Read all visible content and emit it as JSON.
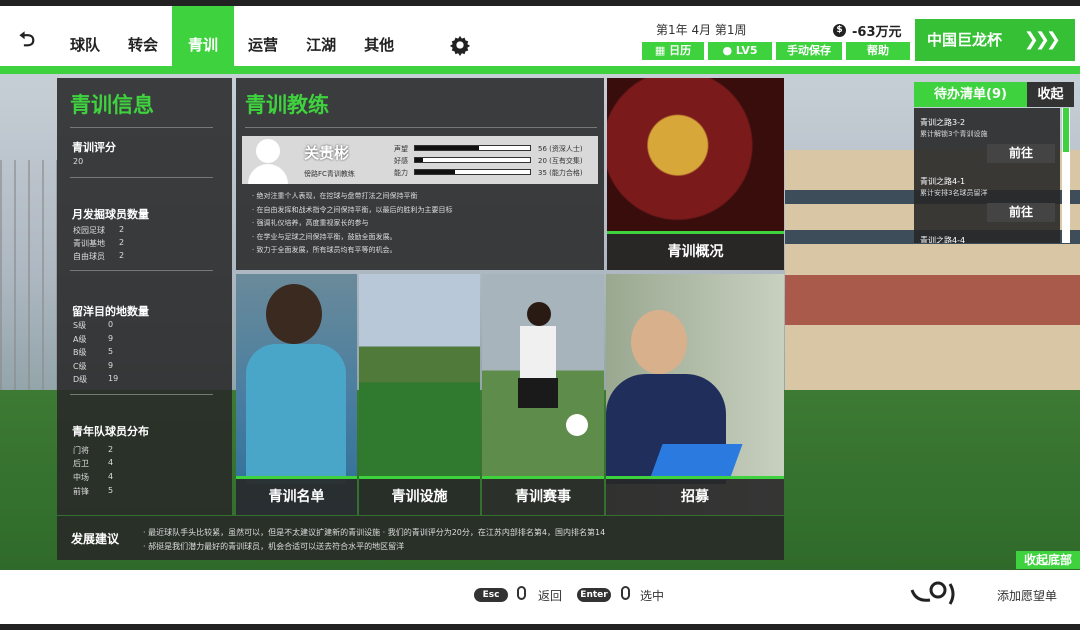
{
  "header": {
    "back_icon": "back-arrow-icon",
    "nav": [
      "球队",
      "转会",
      "青训",
      "运营",
      "江湖",
      "其他"
    ],
    "active_nav": "青训",
    "settings_icon": "gear-icon",
    "date": "第1年 4月 第1周",
    "money": "-63万元",
    "money_icon": "coin-icon",
    "buttons": [
      "日历",
      "LV5",
      "手动保存",
      "帮助"
    ],
    "cup": "中国巨龙杯"
  },
  "youth_info": {
    "title": "青训信息",
    "rating_title": "青训评分",
    "rating": "20",
    "monthly_title": "月发掘球员数量",
    "monthly": [
      {
        "label": "校园足球",
        "value": "2"
      },
      {
        "label": "青训基地",
        "value": "2"
      },
      {
        "label": "自由球员",
        "value": "2"
      }
    ],
    "destination_title": "留洋目的地数量",
    "destinations": [
      {
        "label": "S级",
        "value": "0"
      },
      {
        "label": "A级",
        "value": "9"
      },
      {
        "label": "B级",
        "value": "5"
      },
      {
        "label": "C级",
        "value": "9"
      },
      {
        "label": "D级",
        "value": "19"
      }
    ],
    "youth_dist_title": "青年队球员分布",
    "youth_dist": [
      {
        "label": "门将",
        "value": "2"
      },
      {
        "label": "后卫",
        "value": "4"
      },
      {
        "label": "中场",
        "value": "4"
      },
      {
        "label": "前锋",
        "value": "5"
      }
    ]
  },
  "coach": {
    "title": "青训教练",
    "name": "关贵彬",
    "role": "傍路FC青训教练",
    "stats": [
      {
        "label": "声望",
        "value": "56 (资深人士)",
        "fraction": 0.56
      },
      {
        "label": "好感",
        "value": "20 (互有交集)",
        "fraction": 0.07
      },
      {
        "label": "能力",
        "value": "35 (能力合格)",
        "fraction": 0.35
      }
    ],
    "traits": [
      "· 绝对注重个人表现，在控球与盘带打法之间保持平衡",
      "· 在自由发挥和战术指令之间保持平衡，以最后的胜利为主要目标",
      "· 强调礼仪培养，高度重视家长的参与",
      "· 在学业与足球之间保持平衡，鼓励全面发展。",
      "· 致力于全面发展，所有球员均有平等的机会。"
    ]
  },
  "tiles": {
    "overview": "青训概况",
    "roster": "青训名单",
    "facilities": "青训设施",
    "matches": "青训赛事",
    "recruit": "招募"
  },
  "todo": {
    "title": "待办清单(9)",
    "collapse": "收起",
    "items": [
      {
        "title": "青训之路3-2",
        "desc": "累计解锁3个青训设施",
        "button": "前往"
      },
      {
        "title": "青训之路4-1",
        "desc": "累计安排3名球员留洋",
        "button": "前往"
      },
      {
        "title": "青训之路4-4",
        "desc": "",
        "button": ""
      }
    ]
  },
  "dev": {
    "title": "发展建议",
    "lines": [
      "· 最近球队手头比较紧，虽然可以，但是不太建议扩建新的青训设施 · 我们的青训评分为20分，在江苏内部排名第4，国内排名第14",
      "· 郝挺是我们潜力最好的青训球员，机会合适可以送去符合水平的地区留洋"
    ]
  },
  "collapse_bottom": "收起底部",
  "footer": {
    "esc_key": "Esc",
    "back": "返回",
    "enter_key": "Enter",
    "select": "选中",
    "wishlist": "添加愿望单",
    "steam_icon": "steam-icon"
  },
  "colors": {
    "accent": "#3fd23f",
    "panel": "#282828"
  }
}
